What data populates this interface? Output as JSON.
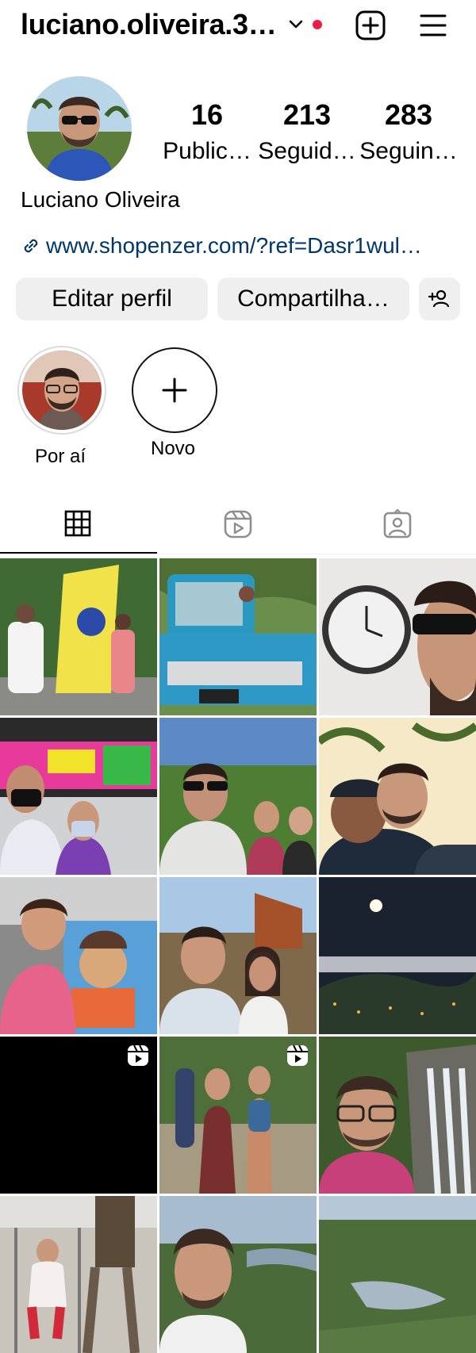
{
  "header": {
    "username": "luciano.oliveira.3…",
    "has_notification_dot": true,
    "icons": [
      "chevron-down-icon",
      "new-post-icon",
      "menu-icon"
    ]
  },
  "profile": {
    "stats": [
      {
        "value": "16",
        "label": "Public…"
      },
      {
        "value": "213",
        "label": "Seguid…"
      },
      {
        "value": "283",
        "label": "Seguin…"
      }
    ],
    "display_name": "Luciano Oliveira",
    "link": "www.shopenzer.com/?ref=Dasr1wul…"
  },
  "actions": {
    "edit": "Editar perfil",
    "share": "Compartilha…",
    "add_person_icon": "add-person-icon"
  },
  "highlights": [
    {
      "label": "Por aí"
    },
    {
      "label": "Novo"
    }
  ],
  "tabs": [
    "grid-icon",
    "reels-icon",
    "tagged-icon"
  ],
  "colors": {
    "link": "#00376b",
    "button_bg": "#efefef",
    "dot": "#ed1e45"
  }
}
